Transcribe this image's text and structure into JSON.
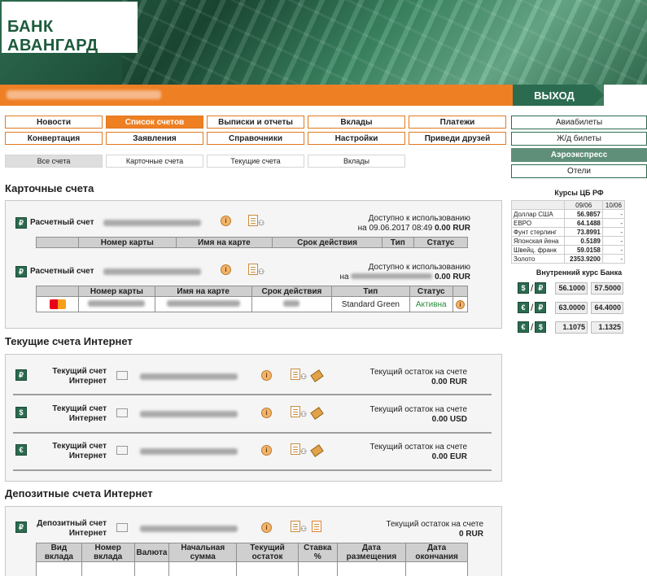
{
  "bank_name": "БАНК АВАНГАРД",
  "header": {
    "logout_label": "ВЫХОД"
  },
  "nav": {
    "row1": [
      "Новости",
      "Список счетов",
      "Выписки и отчеты",
      "Вклады",
      "Платежи"
    ],
    "row2": [
      "Конвертация",
      "Заявления",
      "Справочники",
      "Настройки",
      "Приведи друзей"
    ],
    "active": "Список счетов"
  },
  "subtabs": [
    "Все счета",
    "Карточные счета",
    "Текущие счета",
    "Вклады"
  ],
  "right_links": [
    "Авиабилеты",
    "Ж/д билеты",
    "Аэроэкспресс",
    "Отели"
  ],
  "rates_cb": {
    "title": "Курсы ЦБ РФ",
    "dates": [
      "09/06",
      "10/06"
    ],
    "rows": [
      {
        "name": "Доллар США",
        "v1": "56.9857",
        "v2": "-"
      },
      {
        "name": "ЕВРО",
        "v1": "64.1488",
        "v2": "-"
      },
      {
        "name": "Фунт стерлинг",
        "v1": "73.8991",
        "v2": "-"
      },
      {
        "name": "Японская йена",
        "v1": "0.5189",
        "v2": "-"
      },
      {
        "name": "Швейц. франк",
        "v1": "59.0158",
        "v2": "-"
      },
      {
        "name": "Золото",
        "v1": "2353.9200",
        "v2": "-"
      }
    ]
  },
  "rates_bank": {
    "title": "Внутренний курс Банка",
    "rows": [
      {
        "from": "$",
        "to": "₽",
        "buy": "56.1000",
        "sell": "57.5000"
      },
      {
        "from": "€",
        "to": "₽",
        "buy": "63.0000",
        "sell": "64.4000"
      },
      {
        "from": "€",
        "to": "$",
        "buy": "1.1075",
        "sell": "1.1325"
      }
    ]
  },
  "card_section": {
    "title": "Карточные счета",
    "accounts": [
      {
        "label": "Расчетный счет",
        "avail_label": "Доступно к использованию",
        "avail_date": "на 09.06.2017 08:49",
        "amount": "0.00 RUR"
      },
      {
        "label": "Расчетный счет",
        "avail_label": "Доступно к использованию",
        "avail_date": "на",
        "amount": "0.00 RUR"
      }
    ],
    "columns": [
      "Номер карты",
      "Имя на карте",
      "Срок действия",
      "Тип",
      "Статус"
    ],
    "card_row": {
      "type": "Standard Green",
      "status": "Активна"
    }
  },
  "current_section": {
    "title": "Текущие счета Интернет",
    "accounts": [
      {
        "label1": "Текущий счет",
        "label2": "Интернет",
        "currency": "₽",
        "rest_label": "Текущий остаток на счете",
        "amount": "0.00 RUR"
      },
      {
        "label1": "Текущий счет",
        "label2": "Интернет",
        "currency": "$",
        "rest_label": "Текущий остаток на счете",
        "amount": "0.00 USD"
      },
      {
        "label1": "Текущий счет",
        "label2": "Интернет",
        "currency": "€",
        "rest_label": "Текущий остаток на счете",
        "amount": "0.00 EUR"
      }
    ]
  },
  "deposit_section": {
    "title": "Депозитные счета Интернет",
    "account": {
      "label1": "Депозитный счет",
      "label2": "Интернет",
      "rest_label": "Текущий остаток на счете",
      "amount": "0 RUR"
    },
    "columns": [
      "Вид вклада",
      "Номер вклада",
      "Валюта",
      "Начальная сумма",
      "Текущий остаток",
      "Ставка %",
      "Дата размещения",
      "Дата окончания"
    ]
  },
  "colors": {
    "green": "#2b6b50",
    "orange": "#ee7f23"
  }
}
